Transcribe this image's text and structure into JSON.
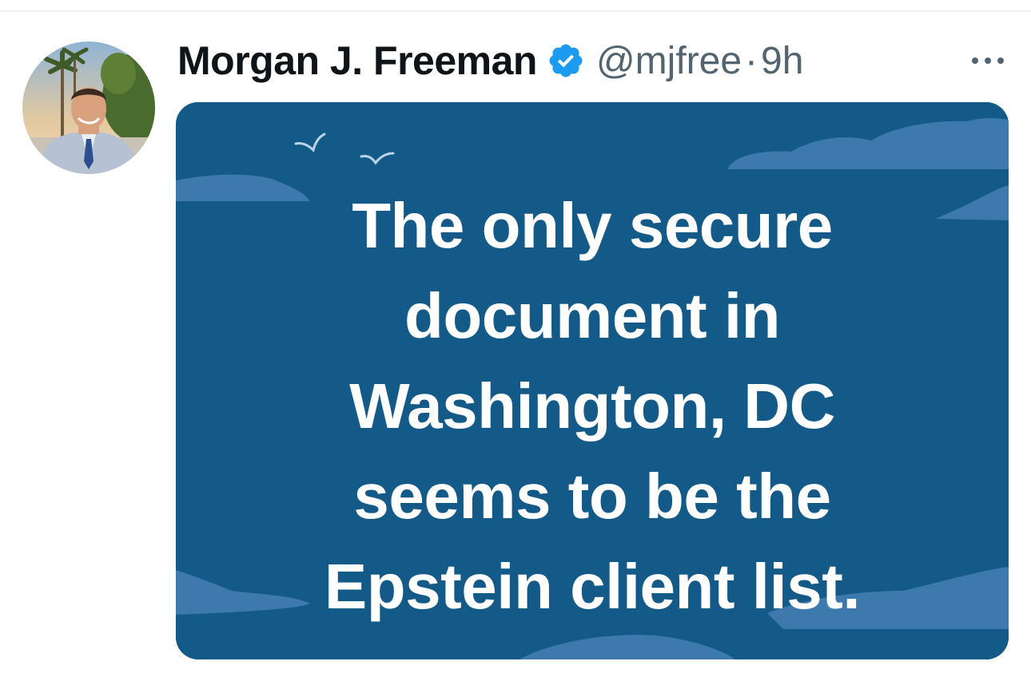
{
  "tweet": {
    "display_name": "Morgan J. Freeman",
    "handle": "@mjfree",
    "separator": "·",
    "time": "9h"
  },
  "icons": {
    "verified": "verified-badge-icon",
    "more": "more-horizontal-icon",
    "birds": "bird-icon"
  },
  "image": {
    "lines": [
      "The only secure",
      "document in",
      "Washington, DC",
      "seems to be the",
      "Epstein client list."
    ]
  },
  "colors": {
    "verified_blue": "#1d9bf0",
    "image_background": "#135a88",
    "cloud": "#3d79ad",
    "secondary_text": "#536471",
    "primary_text": "#0f1419"
  }
}
